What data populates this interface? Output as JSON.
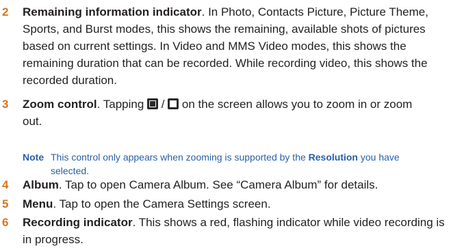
{
  "items": [
    {
      "number": "2",
      "term": "Remaining information indicator",
      "text": ". In Photo, Contacts Picture, Picture Theme, Sports, and Burst modes, this shows the remaining, available shots of pictures based on current settings. In Video and MMS Video modes, this shows the remaining duration that can be recorded. While recording video, this shows the recorded duration."
    },
    {
      "number": "3",
      "term": "Zoom control",
      "text_before": ". Tapping ",
      "separator": " / ",
      "text_after": " on the screen allows you to zoom in or zoom out."
    },
    {
      "number": "4",
      "term": "Album",
      "text": ". Tap to open Camera Album. See “Camera Album” for details."
    },
    {
      "number": "5",
      "term": "Menu",
      "text": ". Tap to open the Camera Settings screen."
    },
    {
      "number": "6",
      "term": "Recording indicator",
      "text": ". This shows a red, flashing indicator while video recording is in progress."
    }
  ],
  "note": {
    "label": "Note",
    "text_before": "This control only appears when zooming is supported by the ",
    "term": "Resolution",
    "text_after": " you have selected."
  },
  "icons": [
    "zoom-in-icon",
    "zoom-out-icon"
  ],
  "colors": {
    "number": "#d5761b",
    "note": "#2860a8",
    "text": "#231f20"
  }
}
